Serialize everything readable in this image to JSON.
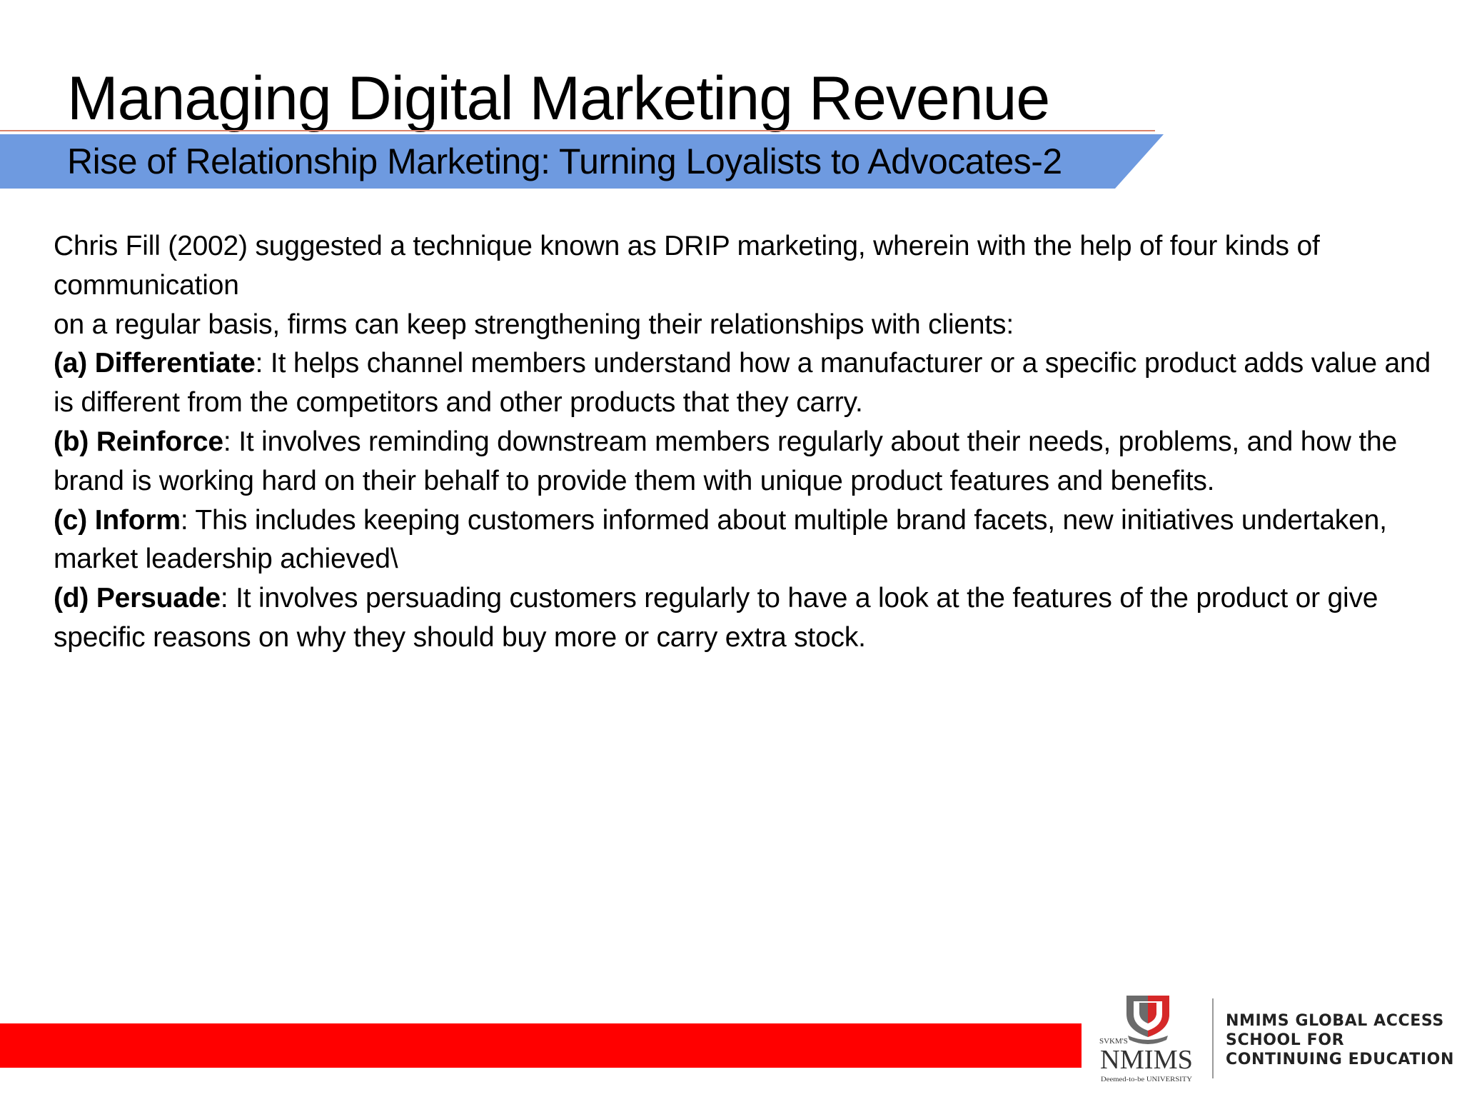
{
  "slide": {
    "title": "Managing Digital Marketing Revenue",
    "subtitle": "Rise of Relationship Marketing: Turning Loyalists to Advocates-2"
  },
  "body": {
    "intro_line1": "Chris Fill (2002) suggested a technique known as DRIP marketing, wherein with the help of four kinds of communication",
    "intro_line2": "on a regular basis, firms can keep strengthening their relationships with clients:",
    "items": [
      {
        "label": "(a) Differentiate",
        "text": ": It helps channel members understand how a manufacturer or a specific product adds value and is different from the competitors and other products that they carry."
      },
      {
        "label": "(b) Reinforce",
        "text": ": It involves reminding downstream members regularly about their needs, problems, and how the brand is working hard on their behalf to provide them with unique product features and benefits."
      },
      {
        "label": "(c) Inform",
        "text": ": This includes keeping customers informed about multiple brand facets, new initiatives undertaken, market leadership achieved\\"
      },
      {
        "label": "(d) Persuade",
        "text": ": It involves persuading customers regularly to have a look at the features of the product or give specific reasons on why they should buy more or carry extra stock."
      }
    ]
  },
  "footer": {
    "logo": {
      "svkm": "SVKM'S",
      "name": "NMIMS",
      "tagline": "Deemed-to-be UNIVERSITY"
    },
    "school_line1": "NMIMS GLOBAL ACCESS",
    "school_line2": "SCHOOL FOR",
    "school_line3": "CONTINUING EDUCATION"
  },
  "colors": {
    "subtitle_band": "#6e9ae0",
    "title_rule": "#d9826a",
    "footer_bar": "#ff0000",
    "crest_gray": "#6b6b6b",
    "crest_red": "#d62828"
  }
}
